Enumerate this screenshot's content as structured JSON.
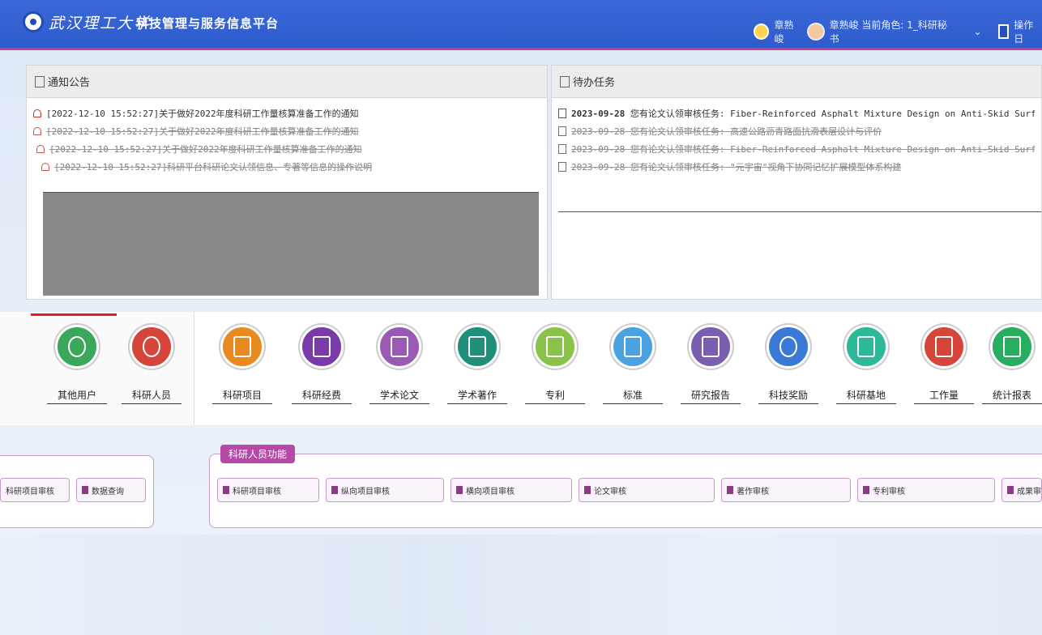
{
  "header": {
    "university_name": "武汉理工大学",
    "platform_name": "科技管理与服务信息平台",
    "user_name": "章熟峻",
    "role_text": "章熟峻 当前角色: 1_科研秘书",
    "ops_label": "操作日"
  },
  "notices": {
    "title": "通知公告",
    "items": [
      "[2022-12-10 15:52:27]关于做好2022年度科研工作量核算准备工作的通知",
      "[2022-12-10 15:52:27]关于做好2022年度科研工作量核算准备工作的通知",
      "[2022-12-10 15:52:27]关于做好2022年度科研工作量核算准备工作的通知",
      "[2022-12-10 15:52:27]科研平台科研论文认领信息、专著等信息的操作说明"
    ]
  },
  "tasks": {
    "title": "待办任务",
    "items": [
      {
        "date": "2023-09-28",
        "text": "您有论文认领审核任务: Fiber-Reinforced Asphalt Mixture Design on Anti-Skid Surfacing for Field"
      },
      {
        "date": "2023-09-28",
        "text": "您有论文认领审核任务: 高速公路沥青路面抗滑表层设计与评价"
      },
      {
        "date": "2023-09-28",
        "text": "您有论文认领审核任务: Fiber-Reinforced Asphalt Mixture Design on Anti-Skid Surfacing"
      },
      {
        "date": "2023-09-28",
        "text": "您有论文认领审核任务: \"元宇宙\"视角下协同记忆扩展模型体系构建"
      }
    ]
  },
  "modules_left": [
    {
      "label": "其他用户",
      "color": "#3aa85a",
      "icon": "gear-people-icon"
    },
    {
      "label": "科研人员",
      "color": "#d6453a",
      "icon": "people-icon"
    }
  ],
  "modules": [
    {
      "label": "科研项目",
      "color": "#e88a20",
      "icon": "project-icon"
    },
    {
      "label": "科研经费",
      "color": "#7a3aa8",
      "icon": "wallet-icon"
    },
    {
      "label": "学术论文",
      "color": "#9b59b6",
      "icon": "paper-icon"
    },
    {
      "label": "学术著作",
      "color": "#1f8e7a",
      "icon": "book-icon"
    },
    {
      "label": "专利",
      "color": "#8bc34a",
      "icon": "patent-icon"
    },
    {
      "label": "标准",
      "color": "#4aa3e0",
      "icon": "standard-icon"
    },
    {
      "label": "研究报告",
      "color": "#7a5fb0",
      "icon": "report-icon"
    },
    {
      "label": "科技奖励",
      "color": "#3a7ad6",
      "icon": "award-icon"
    },
    {
      "label": "科研基地",
      "color": "#2db89a",
      "icon": "base-icon"
    },
    {
      "label": "工作量",
      "color": "#d6453a",
      "icon": "clipboard-icon"
    },
    {
      "label": "统计报表",
      "color": "#27ae60",
      "icon": "chart-icon"
    }
  ],
  "functions": {
    "title": "科研人员功能",
    "left_buttons": [
      "科研项目审核",
      "数据查询"
    ],
    "buttons": [
      "科研项目审核",
      "纵向项目审核",
      "横向项目审核",
      "论文审核",
      "著作审核",
      "专利审核",
      "成果审核"
    ]
  },
  "colors": {
    "header": "#2f5ccc",
    "accent": "#b44aa6"
  }
}
